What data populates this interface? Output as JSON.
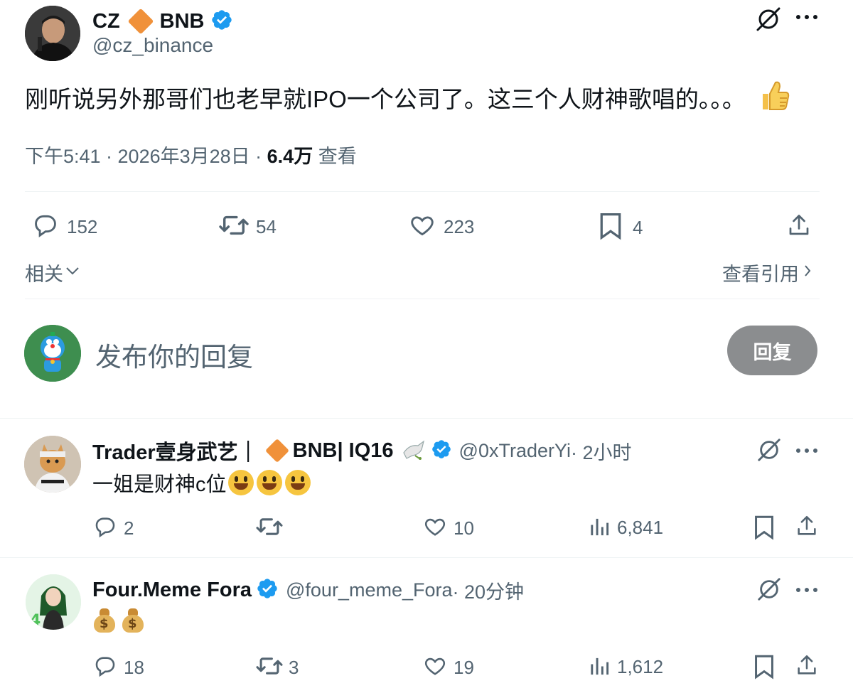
{
  "main_tweet": {
    "name": "CZ",
    "name_suffix": "BNB",
    "handle": "@cz_binance",
    "text": "刚听说另外那哥们也老早就IPO一个公司了。这三个人财神歌唱的。。。",
    "time": "下午5:41 · 2026年3月28日 · ",
    "views": "6.4万",
    "views_label": " 查看",
    "actions": {
      "replies": "152",
      "retweets": "54",
      "likes": "223",
      "bookmarks": "4"
    },
    "related_label": "相关",
    "view_quotes_label": "查看引用"
  },
  "composer": {
    "placeholder": "发布你的回复",
    "reply_button": "回复"
  },
  "replies": [
    {
      "name": "Trader壹身武艺｜",
      "name_suffix": "BNB| IQ16",
      "handle": "@0xTraderYi",
      "time": " · 2小时",
      "text": "一姐是财神c位",
      "replies": "2",
      "retweets": "",
      "likes": "10",
      "views": "6,841"
    },
    {
      "name": "Four.Meme Fora",
      "handle": "@four_meme_Fora",
      "time": " · 20分钟",
      "text": "",
      "replies": "18",
      "retweets": "3",
      "likes": "19",
      "views": "1,612"
    }
  ],
  "colors": {
    "verified": "#1d9bf0",
    "bnb": "#f0913a",
    "text": "#0f1419",
    "secondary": "#536471",
    "reply_button": "#8b8d8f"
  }
}
